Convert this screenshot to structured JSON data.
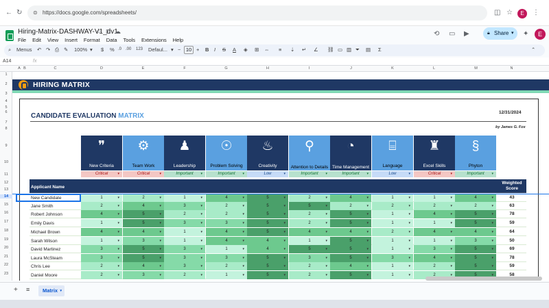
{
  "browser": {
    "url": "https://docs.google.com/spreadsheets/",
    "avatar": "E"
  },
  "doc": {
    "title": "Hiring-Matrix-DASHWAY-V1_dv1",
    "menus": [
      "File",
      "Edit",
      "View",
      "Insert",
      "Format",
      "Data",
      "Tools",
      "Extensions",
      "Help"
    ],
    "share_label": "Share",
    "avatar": "E"
  },
  "toolbar": {
    "menus_label": "Menus",
    "zoom": "100%",
    "currency": "$",
    "percent": "%",
    "decimals": "123",
    "font": "Defaul...",
    "font_size": "10",
    "bold": "B",
    "italic": "I"
  },
  "formula": {
    "name_box": "A14",
    "fx": "fx"
  },
  "columns": [
    "A",
    "B",
    "C",
    "D",
    "E",
    "F",
    "G",
    "H",
    "I",
    "J",
    "K",
    "L",
    "M",
    "N"
  ],
  "rows": [
    "1",
    "2",
    "3",
    "4",
    "5",
    "6",
    "7",
    "8",
    "9",
    "10",
    "11",
    "12",
    "13",
    "14",
    "15",
    "16",
    "17",
    "18",
    "19",
    "20",
    "21",
    "22",
    "23"
  ],
  "header": {
    "band_title": "HIRING MATRIX",
    "eval_title": "CANDIDATE EVALUATION",
    "eval_accent": "MATRIX",
    "date": "12/31/2024",
    "by": "by James G. Fox",
    "app_name": "Applicant Name",
    "weighted_score": "Weighted Score"
  },
  "criteria": [
    {
      "label": "New Criteria",
      "importance": "Critical",
      "icon": "chat-bubbles-icon"
    },
    {
      "label": "Team Work",
      "importance": "Critical",
      "icon": "team-network-icon"
    },
    {
      "label": "Leadership",
      "importance": "Important",
      "icon": "people-hierarchy-icon"
    },
    {
      "label": "Problem Solving",
      "importance": "Important",
      "icon": "head-gears-icon"
    },
    {
      "label": "Creativity",
      "importance": "Low",
      "icon": "lightbulb-icon"
    },
    {
      "label": "Attention to Details",
      "importance": "Important",
      "icon": "magnifier-icon"
    },
    {
      "label": "Time Management",
      "importance": "Important",
      "icon": "clock-icon"
    },
    {
      "label": "Language",
      "importance": "Low",
      "icon": "translate-icon"
    },
    {
      "label": "Excel Skills",
      "importance": "Critical",
      "icon": "podium-icon"
    },
    {
      "label": "Phyton",
      "importance": "Important",
      "icon": "python-icon"
    }
  ],
  "candidates": [
    {
      "name": "New Candidate",
      "scores": [
        "1",
        "2",
        "1",
        "4",
        "5",
        "2",
        "4",
        "1",
        "1",
        "4"
      ],
      "weighted": "43"
    },
    {
      "name": "Jane Smith",
      "scores": [
        "2",
        "4",
        "3",
        "2",
        "5",
        "5",
        "2",
        "2",
        "2",
        "2"
      ],
      "weighted": "63"
    },
    {
      "name": "Robert Johnson",
      "scores": [
        "4",
        "5",
        "2",
        "2",
        "5",
        "2",
        "5",
        "1",
        "4",
        "5"
      ],
      "weighted": "78"
    },
    {
      "name": "Emily Davis",
      "scores": [
        "1",
        "5",
        "3",
        "3",
        "5",
        "2",
        "5",
        "1",
        "1",
        "5"
      ],
      "weighted": "59"
    },
    {
      "name": "Michael Brown",
      "scores": [
        "4",
        "4",
        "1",
        "4",
        "5",
        "4",
        "4",
        "2",
        "4",
        "4"
      ],
      "weighted": "64"
    },
    {
      "name": "Sarah Wilson",
      "scores": [
        "1",
        "3",
        "1",
        "4",
        "4",
        "1",
        "5",
        "1",
        "1",
        "3"
      ],
      "weighted": "50"
    },
    {
      "name": "David Martinez",
      "scores": [
        "3",
        "5",
        "3",
        "1",
        "4",
        "5",
        "5",
        "1",
        "3",
        "5"
      ],
      "weighted": "69"
    },
    {
      "name": "Laura McSteam",
      "scores": [
        "3",
        "5",
        "3",
        "3",
        "5",
        "3",
        "5",
        "3",
        "4",
        "5"
      ],
      "weighted": "78"
    },
    {
      "name": "Chris Lee",
      "scores": [
        "2",
        "4",
        "3",
        "2",
        "5",
        "2",
        "4",
        "1",
        "2",
        "5"
      ],
      "weighted": "59"
    },
    {
      "name": "Daniel Moore",
      "scores": [
        "2",
        "3",
        "2",
        "1",
        "5",
        "2",
        "5",
        "1",
        "2",
        "5"
      ],
      "weighted": "58"
    }
  ],
  "score_colors": {
    "1": "#c3f3dd",
    "2": "#a8ebc8",
    "3": "#85daa8",
    "4": "#6dc98e",
    "5": "#4aa06a"
  },
  "importance_colors": {
    "Critical": "#f4c7c3",
    "Important": "#b7e1cd",
    "Low": "#c6dbf7"
  },
  "tabs": {
    "active": "Matrix"
  }
}
